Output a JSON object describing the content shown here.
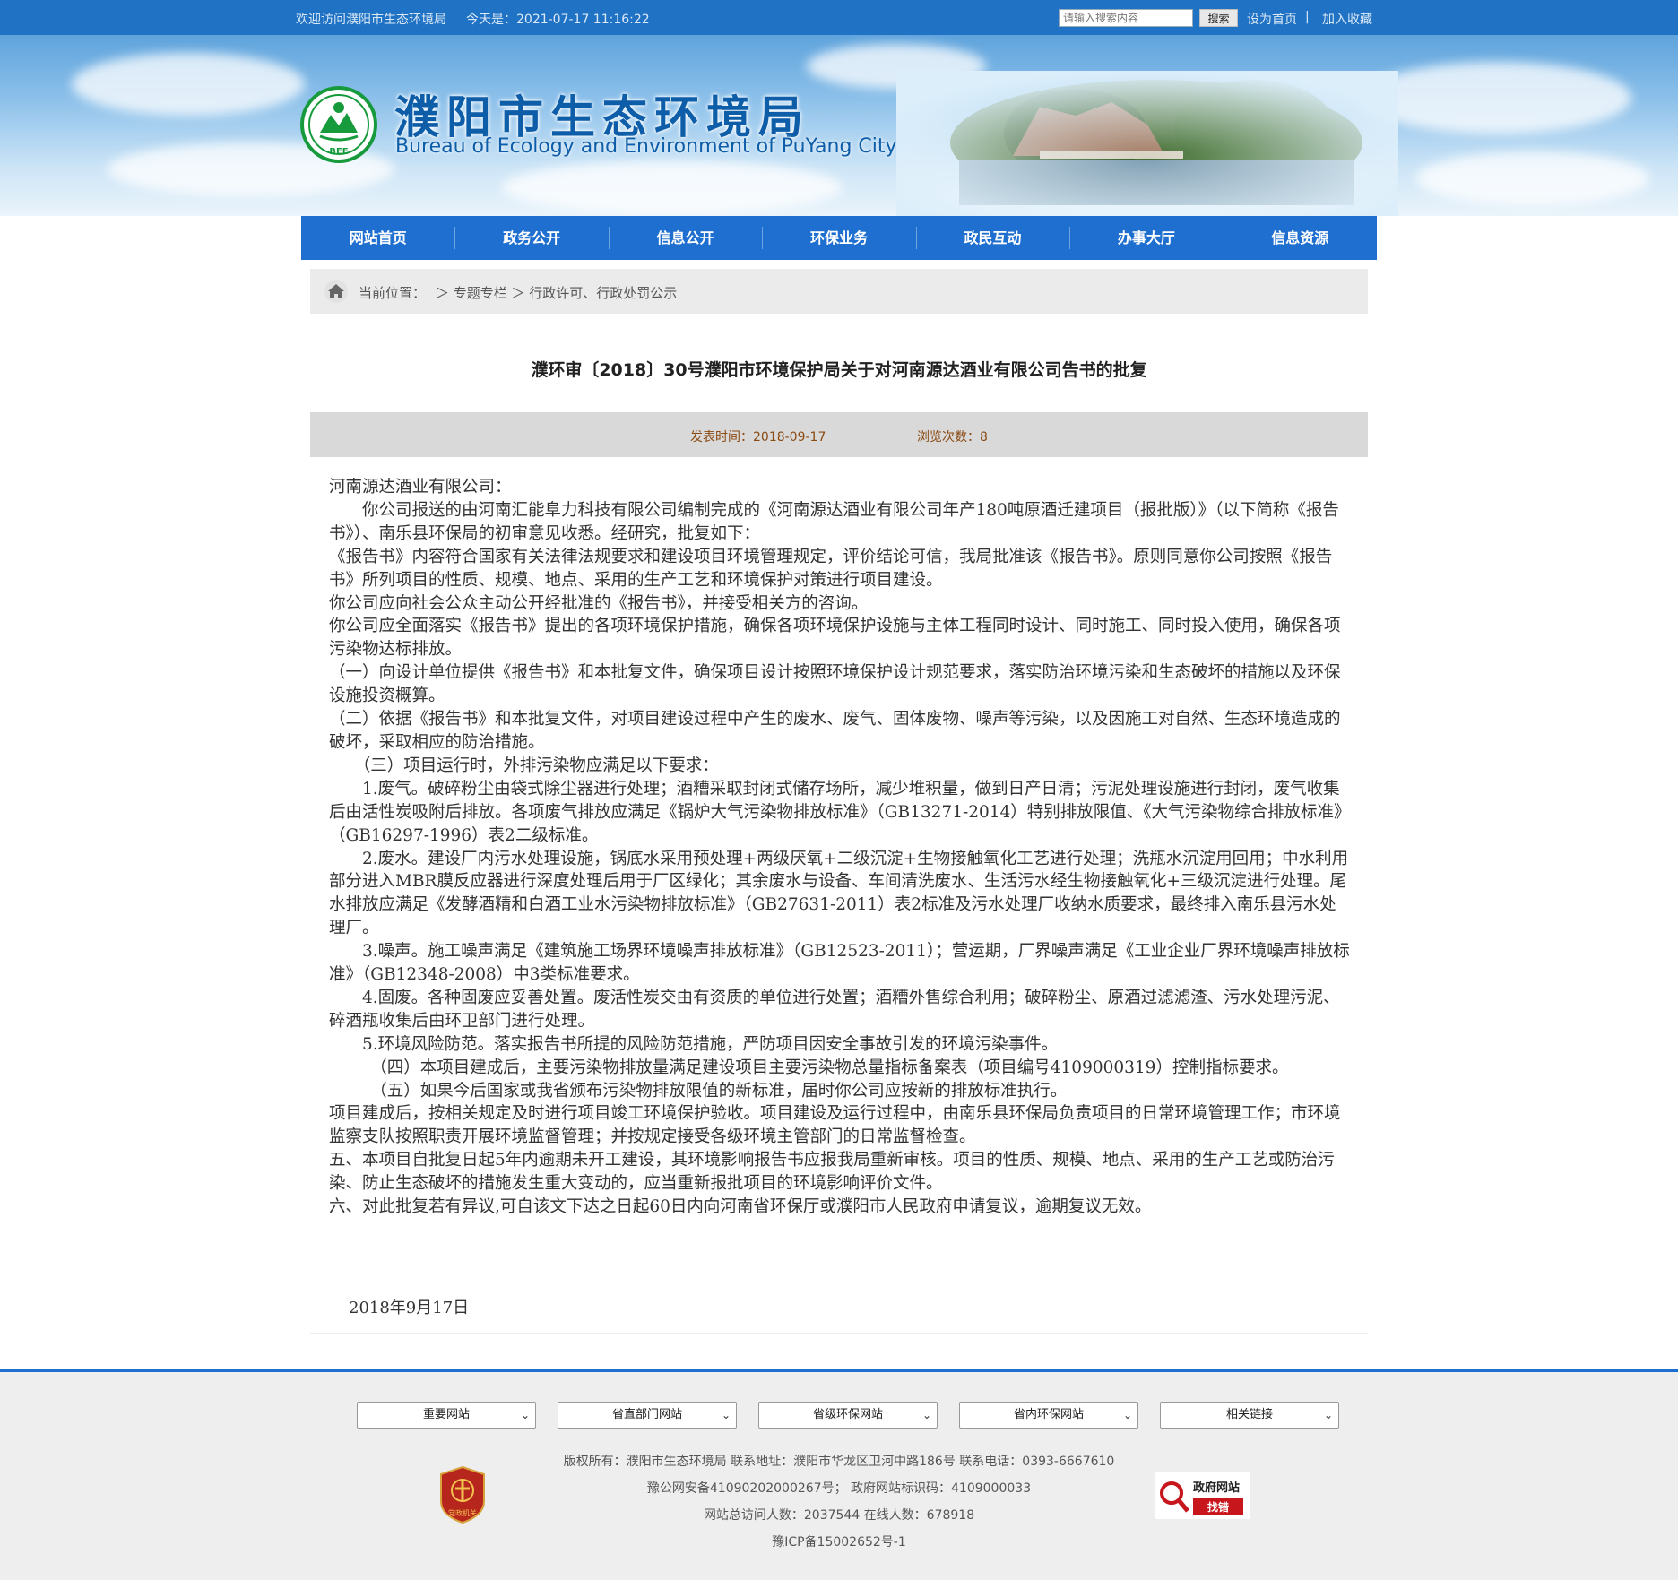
{
  "topbar": {
    "welcome": "欢迎访问濮阳市生态环境局",
    "today": "今天是：2021-07-17 11:16:22",
    "search_placeholder": "请输入搜索内容",
    "search_button": "搜索",
    "set_home": "设为首页",
    "separator": "|",
    "add_favorite": "加入收藏"
  },
  "header": {
    "title_cn": "濮阳市生态环境局",
    "title_en": "Bureau of Ecology and Environment of PuYang City",
    "emblem_text": "BEE"
  },
  "nav": [
    "网站首页",
    "政务公开",
    "信息公开",
    "环保业务",
    "政民互动",
    "办事大厅",
    "信息资源"
  ],
  "breadcrumb": {
    "label": "当前位置：",
    "path": "＞ 专题专栏 ＞ 行政许可、行政处罚公示"
  },
  "article": {
    "title": "濮环审〔2018〕30号濮阳市环境保护局关于对河南源达酒业有限公司告书的批复",
    "publish": "发表时间：2018-09-17",
    "views": "浏览次数：8",
    "paragraphs": [
      "河南源达酒业有限公司：",
      "　　你公司报送的由河南汇能阜力科技有限公司编制完成的《河南源达酒业有限公司年产180吨原酒迁建项目（报批版）》（以下简称《报告书》）、南乐县环保局的初审意见收悉。经研究，批复如下：",
      "《报告书》内容符合国家有关法律法规要求和建设项目环境管理规定，评价结论可信，我局批准该《报告书》。原则同意你公司按照《报告书》所列项目的性质、规模、地点、采用的生产工艺和环境保护对策进行项目建设。",
      "你公司应向社会公众主动公开经批准的《报告书》，并接受相关方的咨询。",
      "你公司应全面落实《报告书》提出的各项环境保护措施，确保各项环境保护设施与主体工程同时设计、同时施工、同时投入使用，确保各项污染物达标排放。",
      "（一）向设计单位提供《报告书》和本批复文件，确保项目设计按照环境保护设计规范要求，落实防治环境污染和生态破坏的措施以及环保设施投资概算。",
      "（二）依据《报告书》和本批复文件，对项目建设过程中产生的废水、废气、固体废物、噪声等污染，以及因施工对自然、生态环境造成的破坏，采取相应的防治措施。",
      "　　（三）项目运行时，外排污染物应满足以下要求：",
      "　　1.废气。破碎粉尘由袋式除尘器进行处理；酒糟采取封闭式储存场所，减少堆积量，做到日产日清；污泥处理设施进行封闭，废气收集后由活性炭吸附后排放。各项废气排放应满足《锅炉大气污染物排放标准》（GB13271-2014）特别排放限值、《大气污染物综合排放标准》（GB16297-1996）表2二级标准。",
      "　　2.废水。建设厂内污水处理设施，锅底水采用预处理+两级厌氧+二级沉淀+生物接触氧化工艺进行处理；洗瓶水沉淀用回用；中水利用部分进入MBR膜反应器进行深度处理后用于厂区绿化；其余废水与设备、车间清洗废水、生活污水经生物接触氧化+三级沉淀进行处理。尾水排放应满足《发酵酒精和白酒工业水污染物排放标准》（GB27631-2011）表2标准及污水处理厂收纳水质要求，最终排入南乐县污水处理厂。",
      "　　3.噪声。施工噪声满足《建筑施工场界环境噪声排放标准》（GB12523-2011）；营运期，厂界噪声满足《工业企业厂界环境噪声排放标准》（GB12348-2008）中3类标准要求。",
      "　　4.固废。各种固废应妥善处置。废活性炭交由有资质的单位进行处置；酒糟外售综合利用；破碎粉尘、原酒过滤滤渣、污水处理污泥、碎酒瓶收集后由环卫部门进行处理。",
      "　　5.环境风险防范。落实报告书所提的风险防范措施，严防项目因安全事故引发的环境污染事件。",
      "　　　（四）本项目建成后，主要污染物排放量满足建设项目主要污染物总量指标备案表（项目编号4109000319）控制指标要求。",
      "　　　（五）如果今后国家或我省颁布污染物排放限值的新标准，届时你公司应按新的排放标准执行。",
      "项目建成后，按相关规定及时进行项目竣工环境保护验收。项目建设及运行过程中，由南乐县环保局负责项目的日常环境管理工作；市环境监察支队按照职责开展环境监督管理；并按规定接受各级环境主管部门的日常监督检查。",
      "五、本项目自批复日起5年内逾期未开工建设，其环境影响报告书应报我局重新审核。项目的性质、规模、地点、采用的生产工艺或防治污染、防止生态破坏的措施发生重大变动的，应当重新报批项目的环境影响评价文件。",
      "六、对此批复若有异议,可自该文下达之日起60日内向河南省环保厅或濮阳市人民政府申请复议，逾期复议无效。"
    ],
    "date": "2018年9月17日"
  },
  "footer": {
    "selects": [
      "重要网站",
      "省直部门网站",
      "省级环保网站",
      "省内环保网站",
      "相关链接"
    ],
    "copyright": "版权所有：濮阳市生态环境局  联系地址：濮阳市华龙区卫河中路186号  联系电话：0393-6667610",
    "security": "豫公网安备41090202000267号；  政府网站标识码：4109000033",
    "visits": "网站总访问人数：2037544  在线人数：678918",
    "icp": "豫ICP备15002652号-1",
    "badge_left_text": "党政机关",
    "badge_right_line1": "政府网站",
    "badge_right_line2": "找错"
  },
  "colors": {
    "topbar": "#1f72c4",
    "nav": "#1e6fcf",
    "title_blue": "#0d5da8",
    "meta_text": "#8a4a12"
  }
}
